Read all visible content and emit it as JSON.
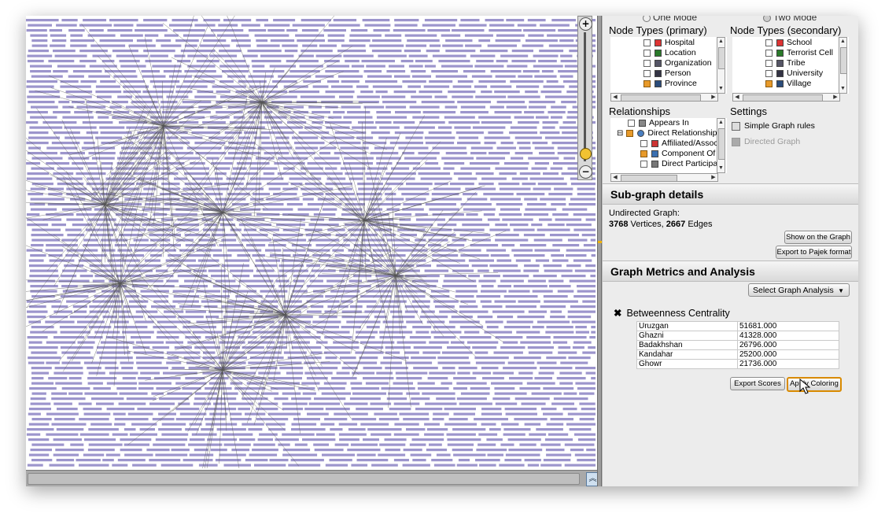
{
  "panel": {
    "mode": {
      "one": "One Mode",
      "two": "Two Mode"
    },
    "node_types_primary": {
      "title": "Node Types (primary)",
      "items": [
        {
          "label": "Hospital",
          "icon": "hospital-icon",
          "checked": false
        },
        {
          "label": "Location",
          "icon": "location-icon",
          "checked": false
        },
        {
          "label": "Organization",
          "icon": "organization-icon",
          "checked": false
        },
        {
          "label": "Person",
          "icon": "person-icon",
          "checked": false
        },
        {
          "label": "Province",
          "icon": "province-icon",
          "checked": true
        }
      ]
    },
    "node_types_secondary": {
      "title": "Node Types (secondary)",
      "items": [
        {
          "label": "School",
          "icon": "school-icon",
          "checked": false
        },
        {
          "label": "Terrorist Cell",
          "icon": "terrorist-cell-icon",
          "checked": false
        },
        {
          "label": "Tribe",
          "icon": "tribe-icon",
          "checked": false
        },
        {
          "label": "University",
          "icon": "university-icon",
          "checked": false
        },
        {
          "label": "Village",
          "icon": "village-icon",
          "checked": true
        }
      ]
    },
    "relationships": {
      "title": "Relationships",
      "items": [
        {
          "label": "Appears In",
          "icon": "pencil-icon"
        },
        {
          "label": "Direct Relationship",
          "icon": "question-icon"
        },
        {
          "label": "Affiliated/Assoc",
          "icon": "flag-icon"
        },
        {
          "label": "Component Of",
          "icon": "component-icon"
        },
        {
          "label": "Direct Participa",
          "icon": "pencil-icon"
        }
      ]
    },
    "settings": {
      "title": "Settings",
      "simple_graph_rules": "Simple Graph rules",
      "directed_graph": "Directed Graph"
    },
    "subgraph": {
      "title": "Sub-graph details",
      "graph_type": "Undirected Graph:",
      "vertices": "3768",
      "vertices_label": "Vertices,",
      "edges": "2667",
      "edges_label": "Edges",
      "show_button": "Show on the Graph",
      "export_button": "Export to Pajek format"
    },
    "metrics": {
      "title": "Graph Metrics and Analysis",
      "select_label": "Select Graph Analysis",
      "analysis_title": "Betweenness Centrality",
      "rows": [
        {
          "name": "Uruzgan",
          "value": "51681.000"
        },
        {
          "name": "Ghazni",
          "value": "41328.000"
        },
        {
          "name": "Badakhshan",
          "value": "26796.000"
        },
        {
          "name": "Kandahar",
          "value": "25200.000"
        },
        {
          "name": "Ghowr",
          "value": "21736.000"
        }
      ],
      "export_scores": "Export Scores",
      "apply_coloring": "Apply Coloring"
    }
  },
  "colors": {
    "node_label": "#9c95cc",
    "edge": "#555555",
    "accent": "#f1c232",
    "apply_border": "#d98a00"
  }
}
